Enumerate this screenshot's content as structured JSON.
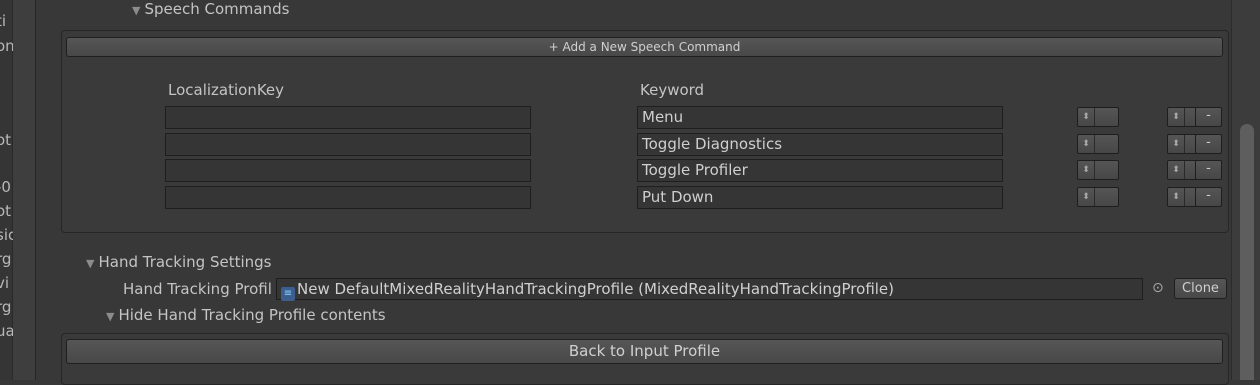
{
  "left_fragments": [
    "ti",
    "on",
    "ot",
    "-0",
    "ot",
    "sic",
    "rg",
    "vi",
    "rg",
    "ua"
  ],
  "speech": {
    "section_label": "Speech Commands",
    "add_button": "+ Add a New Speech Command",
    "col_localization": "LocalizationKey",
    "col_keyword": "Keyword",
    "rows": [
      {
        "localization_key": "",
        "keyword": "Menu"
      },
      {
        "localization_key": "",
        "keyword": "Toggle Diagnostics"
      },
      {
        "localization_key": "",
        "keyword": "Toggle Profiler"
      },
      {
        "localization_key": "",
        "keyword": "Put Down"
      }
    ],
    "remove_label": "-"
  },
  "hand_tracking": {
    "section_label": "Hand Tracking Settings",
    "profile_label": "Hand Tracking Profil",
    "profile_value": "New DefaultMixedRealityHandTrackingProfile (MixedRealityHandTrackingProfile)",
    "clone_button": "Clone",
    "hide_contents": "Hide Hand Tracking Profile contents"
  },
  "back_button": "Back to Input Profile"
}
